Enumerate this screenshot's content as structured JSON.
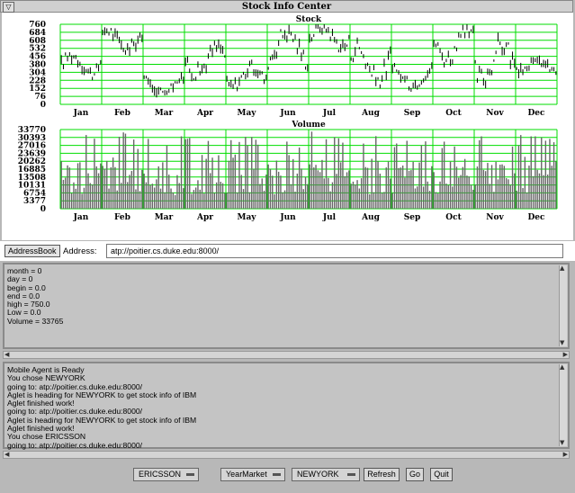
{
  "window": {
    "title": "Stock Info Center",
    "menu_glyph": "▽"
  },
  "chart_data": [
    {
      "type": "bar",
      "title": "Stock",
      "categories": [
        "Jan",
        "Feb",
        "Mar",
        "Apr",
        "May",
        "Jun",
        "Jul",
        "Aug",
        "Sep",
        "Oct",
        "Nov",
        "Dec"
      ],
      "yticks": [
        760,
        684,
        608,
        532,
        456,
        380,
        304,
        228,
        152,
        76,
        0
      ],
      "ylim": [
        0,
        760
      ],
      "monthly_mean": [
        380,
        620,
        180,
        420,
        260,
        560,
        650,
        390,
        260,
        560,
        410,
        360
      ],
      "monthly_high": [
        530,
        720,
        300,
        600,
        430,
        710,
        750,
        700,
        380,
        740,
        720,
        420
      ],
      "monthly_low": [
        240,
        420,
        110,
        200,
        140,
        250,
        420,
        170,
        130,
        330,
        170,
        240
      ],
      "grid": true,
      "grid_color": "#00dd00",
      "bar_color": "#000000"
    },
    {
      "type": "bar",
      "title": "Volume",
      "categories": [
        "Jan",
        "Feb",
        "Mar",
        "Apr",
        "May",
        "Jun",
        "Jul",
        "Aug",
        "Sep",
        "Oct",
        "Nov",
        "Dec"
      ],
      "yticks": [
        33770,
        30393,
        27016,
        23639,
        20262,
        16885,
        13508,
        10131,
        6754,
        3377,
        0
      ],
      "ylim": [
        0,
        33770
      ],
      "monthly_mean": [
        16000,
        19000,
        15000,
        17000,
        17500,
        17000,
        18500,
        17000,
        16500,
        17000,
        15500,
        16500
      ],
      "monthly_peak": [
        33000,
        33765,
        31000,
        32000,
        31500,
        30500,
        33000,
        31000,
        30000,
        30000,
        31000,
        31500
      ],
      "grid": true,
      "grid_color": "#00dd00",
      "bar_color": "#666666"
    }
  ],
  "address": {
    "button_label": "AddressBook",
    "label": "Address:",
    "value": "atp://poitier.cs.duke.edu:8000/"
  },
  "info_lines": [
    "month = 0",
    "day = 0",
    "begin = 0.0",
    "end = 0.0",
    "high = 750.0",
    "Low = 0.0",
    "Volume = 33765"
  ],
  "log_lines": [
    "Mobile Agent is Ready",
    "You chose NEWYORK",
    "going to: atp://poitier.cs.duke.edu:8000/",
    "Aglet is heading for NEWYORK to get stock info of IBM",
    "Aglet finished work!",
    "going to: atp://poitier.cs.duke.edu:8000/",
    "Aglet is heading for NEWYORK to get stock info of IBM",
    "Aglet finished work!",
    "You chose ERICSSON",
    "going to: atp://poitier.cs.duke.edu:8000/"
  ],
  "controls": {
    "company": "ERICSSON",
    "period": "YearMarket",
    "exchange": "NEWYORK",
    "refresh_label": "Refresh",
    "go_label": "Go",
    "quit_label": "Quit"
  },
  "scroll_arrows": {
    "up": "▲",
    "down": "▼",
    "left": "◀",
    "right": "▶"
  }
}
